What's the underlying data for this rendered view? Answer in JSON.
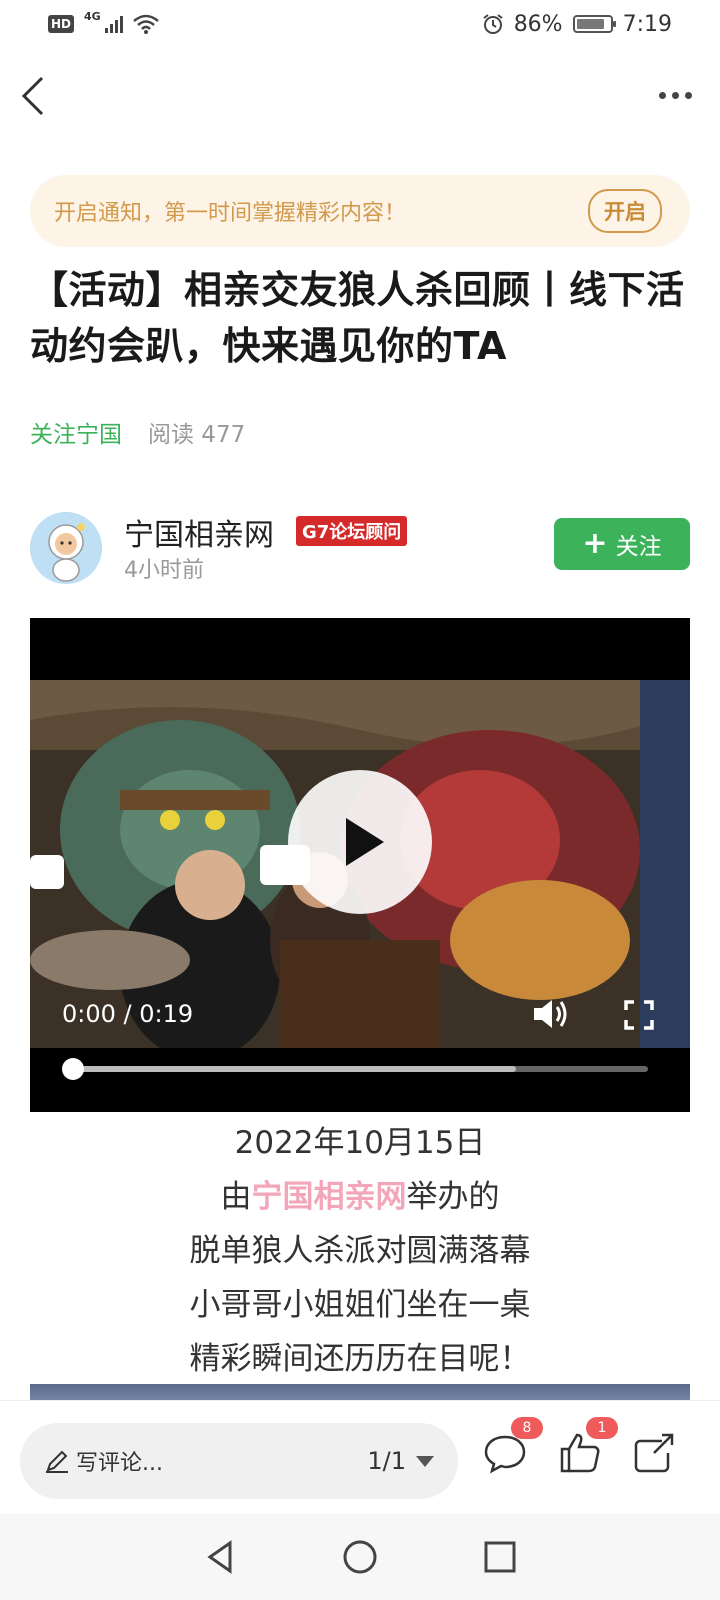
{
  "status_bar": {
    "hd": "HD",
    "network": "4G",
    "battery_pct": "86%",
    "time": "7:19",
    "battery_level": 0.86
  },
  "notify_banner": {
    "text": "开启通知，第一时间掌握精彩内容！",
    "button": "开启"
  },
  "article": {
    "title": "【活动】相亲交友狼人杀回顾丨线下活动约会趴，快来遇见你的TA",
    "follow_link": "关注宁国",
    "read_count": "阅读 477"
  },
  "author": {
    "name": "宁国相亲网",
    "badge": "G7论坛顾问",
    "time": "4小时前",
    "follow_button": "关注"
  },
  "video": {
    "time": "0:00 / 0:19",
    "progress": 0.0,
    "buffered": 0.77
  },
  "body": {
    "line1": "2022年10月15日",
    "line2_prefix": "由",
    "line2_highlight": "宁国相亲网",
    "line2_suffix": "举办的",
    "line3": "脱单狼人杀派对圆满落幕",
    "line4": "小哥哥小姐姐们坐在一桌",
    "line5": "精彩瞬间还历历在目呢！"
  },
  "bottom_bar": {
    "comment_placeholder": "写评论...",
    "page_indicator": "1/1",
    "comment_count": "8",
    "like_count": "1"
  },
  "colors": {
    "accent_green": "#3cb35a",
    "notify_bg": "#fdf3e6",
    "notify_text": "#d19a4c",
    "highlight_pink": "#f3a6b9",
    "badge_red": "#ef5a5a"
  }
}
